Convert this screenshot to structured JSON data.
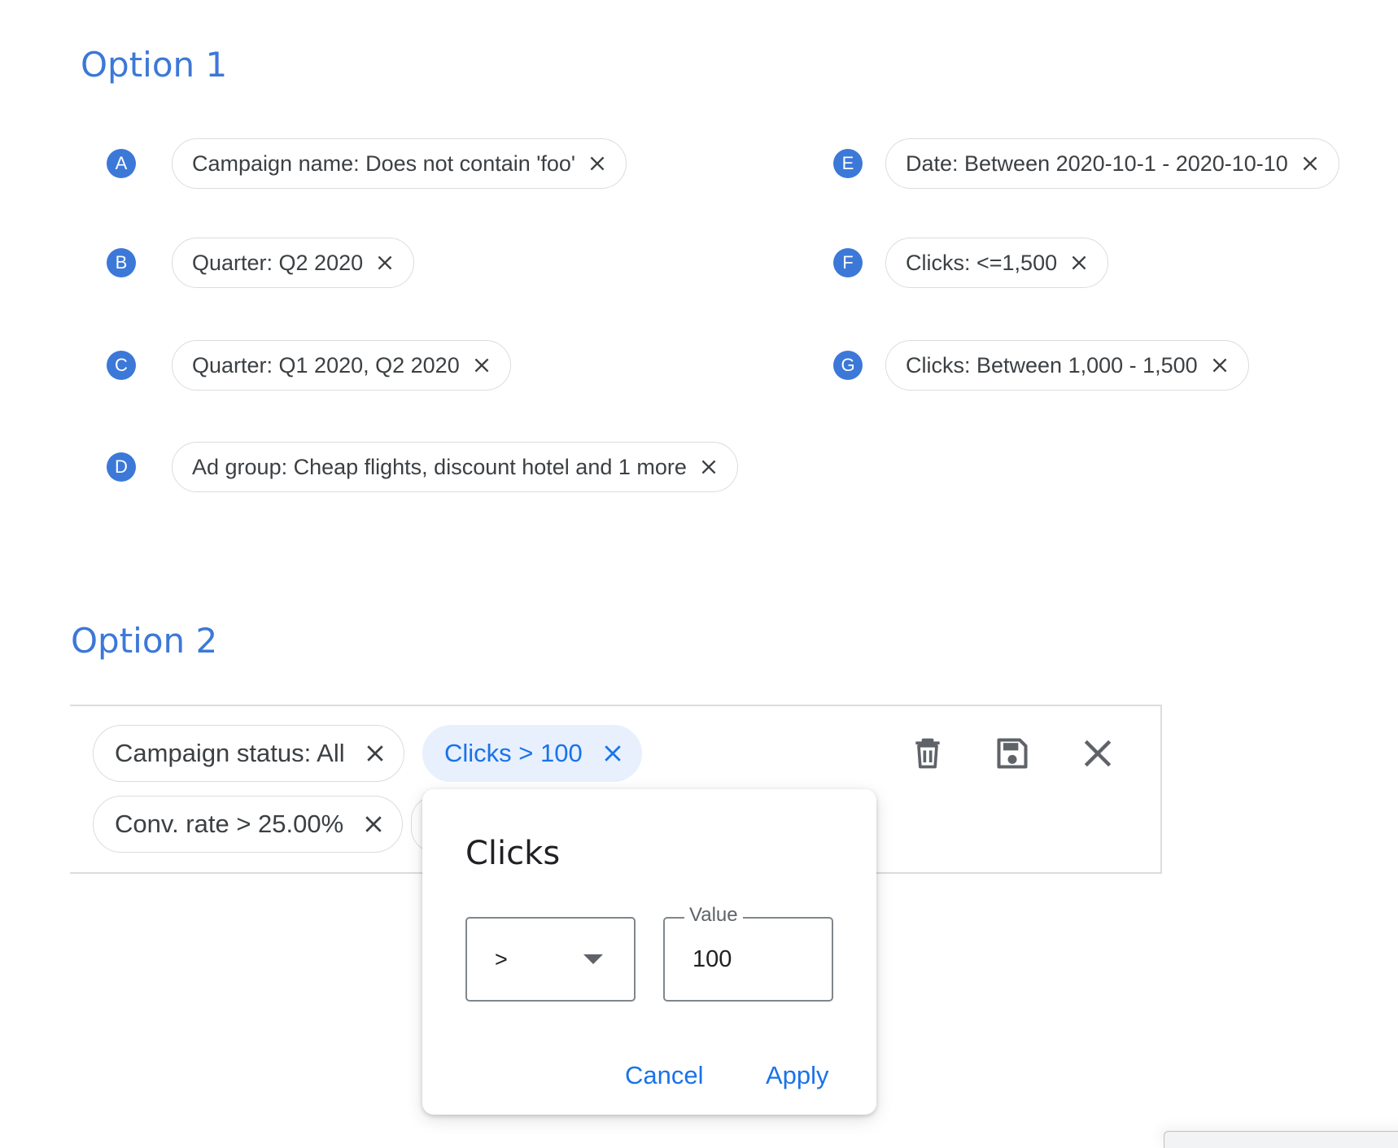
{
  "option1": {
    "title": "Option 1",
    "rows": [
      {
        "badge": "A",
        "chip": "Campaign name: Does not contain 'foo'"
      },
      {
        "badge": "B",
        "chip": "Quarter: Q2 2020"
      },
      {
        "badge": "C",
        "chip": "Quarter: Q1 2020, Q2 2020"
      },
      {
        "badge": "D",
        "chip": "Ad group: Cheap flights, discount hotel and 1 more"
      },
      {
        "badge": "E",
        "chip": "Date: Between 2020-10-1 - 2020-10-10"
      },
      {
        "badge": "F",
        "chip": "Clicks: <=1,500"
      },
      {
        "badge": "G",
        "chip": "Clicks: Between 1,000 - 1,500"
      }
    ]
  },
  "option2": {
    "title": "Option 2",
    "chips": [
      {
        "label": "Campaign status: All"
      },
      {
        "label": "Clicks > 100",
        "active": true
      },
      {
        "label": "Conv. rate > 25.00%"
      }
    ],
    "toolbar": [
      "delete-icon",
      "save-icon",
      "close-icon"
    ],
    "popup": {
      "title": "Clicks",
      "operator": ">",
      "value_label": "Value",
      "value": "100",
      "cancel": "Cancel",
      "apply": "Apply"
    }
  },
  "colors": {
    "accent": "#3c78d8",
    "link": "#1a73e8",
    "chip_active_bg": "#e8f0fe",
    "chip_border": "#dadce0"
  }
}
